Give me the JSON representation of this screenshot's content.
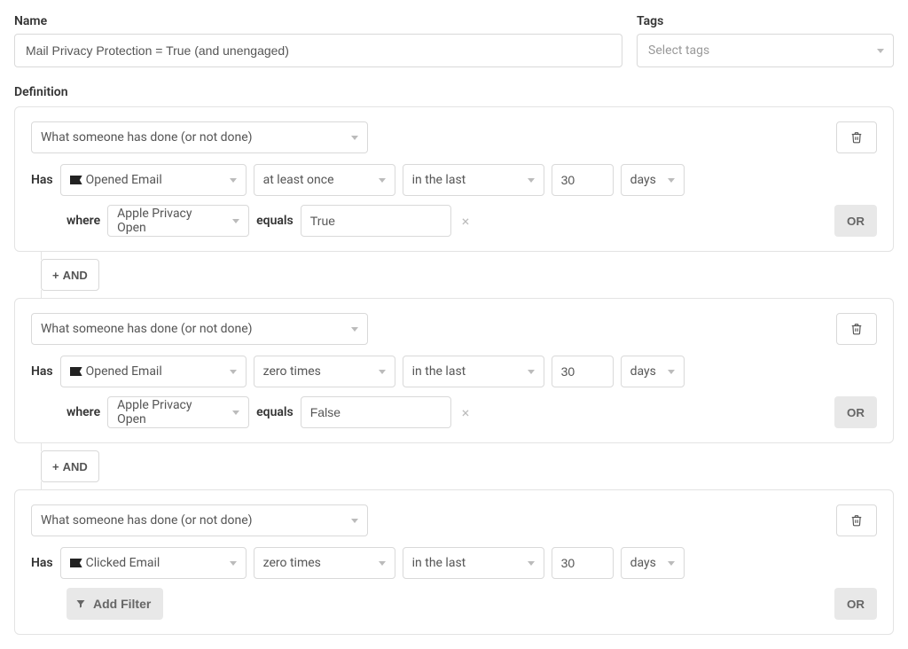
{
  "labels": {
    "name": "Name",
    "tags": "Tags",
    "tags_placeholder": "Select tags",
    "definition": "Definition",
    "and": "AND",
    "or": "OR",
    "has": "Has",
    "where": "where",
    "equals": "equals",
    "add_filter": "Add Filter"
  },
  "name_value": "Mail Privacy Protection = True (and unengaged)",
  "blocks": [
    {
      "condition_type": "What someone has done (or not done)",
      "event": "Opened Email",
      "frequency": "at least once",
      "timeframe": "in the last",
      "number": "30",
      "unit": "days",
      "filter_prop": "Apple Privacy Open",
      "filter_value": "True",
      "has_filter_row": true
    },
    {
      "condition_type": "What someone has done (or not done)",
      "event": "Opened Email",
      "frequency": "zero times",
      "timeframe": "in the last",
      "number": "30",
      "unit": "days",
      "filter_prop": "Apple Privacy Open",
      "filter_value": "False",
      "has_filter_row": true
    },
    {
      "condition_type": "What someone has done (or not done)",
      "event": "Clicked Email",
      "frequency": "zero times",
      "timeframe": "in the last",
      "number": "30",
      "unit": "days",
      "has_filter_row": false
    }
  ]
}
